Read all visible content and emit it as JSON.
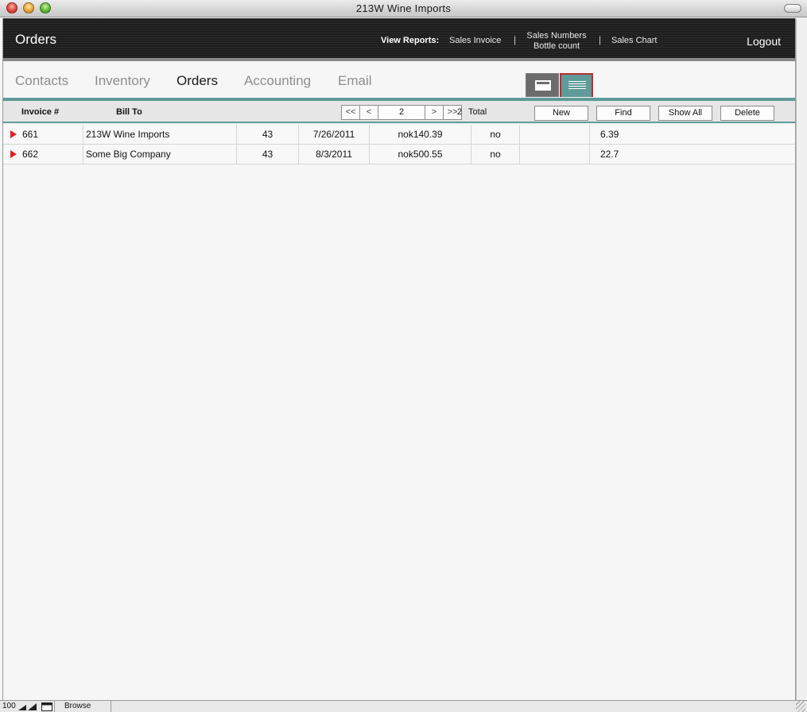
{
  "window": {
    "title": "213W Wine Imports"
  },
  "header": {
    "page_title": "Orders",
    "reports_label": "View Reports:",
    "report_links": {
      "sales_invoice": "Sales Invoice",
      "sales_numbers": "Sales Numbers",
      "bottle_count": "Bottle count",
      "sales_chart": "Sales Chart",
      "separator": "|"
    },
    "logout": "Logout"
  },
  "tabs": {
    "contacts": "Contacts",
    "inventory": "Inventory",
    "orders": "Orders",
    "accounting": "Accounting",
    "email": "Email"
  },
  "columns": {
    "invoice": "Invoice #",
    "bill_to": "Bill To"
  },
  "nav": {
    "first": "<<",
    "prev": "<",
    "page": "2",
    "next": ">",
    "last": ">>",
    "total_count": "2",
    "total_label": "Total"
  },
  "actions": {
    "new": "New",
    "find": "Find",
    "show_all": "Show All",
    "delete": "Delete"
  },
  "rows": [
    {
      "invoice": "661",
      "bill_to": "213W Wine Imports",
      "qty": "43",
      "date": "7/26/2011",
      "amount": "nok140.39",
      "paid": "no",
      "blank": "",
      "value": "6.39"
    },
    {
      "invoice": "662",
      "bill_to": "Some Big Company",
      "qty": "43",
      "date": "8/3/2011",
      "amount": "nok500.55",
      "paid": "no",
      "blank": "",
      "value": "22.7"
    }
  ],
  "status": {
    "zoom": "100",
    "mode": "Browse"
  },
  "colors": {
    "accent": "#5f9b98",
    "marker": "#e02020",
    "header_bg": "#1e1e1e"
  }
}
